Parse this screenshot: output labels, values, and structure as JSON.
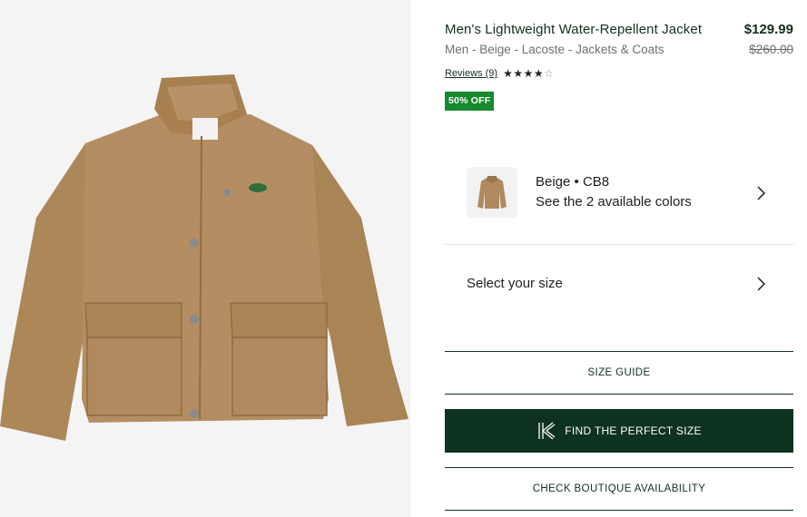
{
  "product": {
    "title": "Men's Lightweight Water-Repellent Jacket",
    "breadcrumb": "Men - Beige - Lacoste - Jackets & Coats",
    "price_current": "$129.99",
    "price_original": "$260.00",
    "reviews_label": "Reviews (9)",
    "rating": 4,
    "rating_max": 5,
    "discount_badge": "50% OFF",
    "image_icon": "jacket-product-image"
  },
  "color_selector": {
    "name": "Beige • CB8",
    "available_text": "See the 2 available colors",
    "icon": "chevron-right-icon"
  },
  "size_selector": {
    "label": "Select your size",
    "icon": "chevron-right-icon"
  },
  "buttons": {
    "size_guide": "SIZE GUIDE",
    "find_size": "FIND THE PERFECT SIZE",
    "find_size_icon": "k-logo-icon",
    "boutique": "CHECK BOUTIQUE AVAILABILITY"
  },
  "colors": {
    "brand_green": "#13301f",
    "primary_button": "#0e3220",
    "badge_green": "#178a2f",
    "jacket_beige": "#b48e62"
  }
}
